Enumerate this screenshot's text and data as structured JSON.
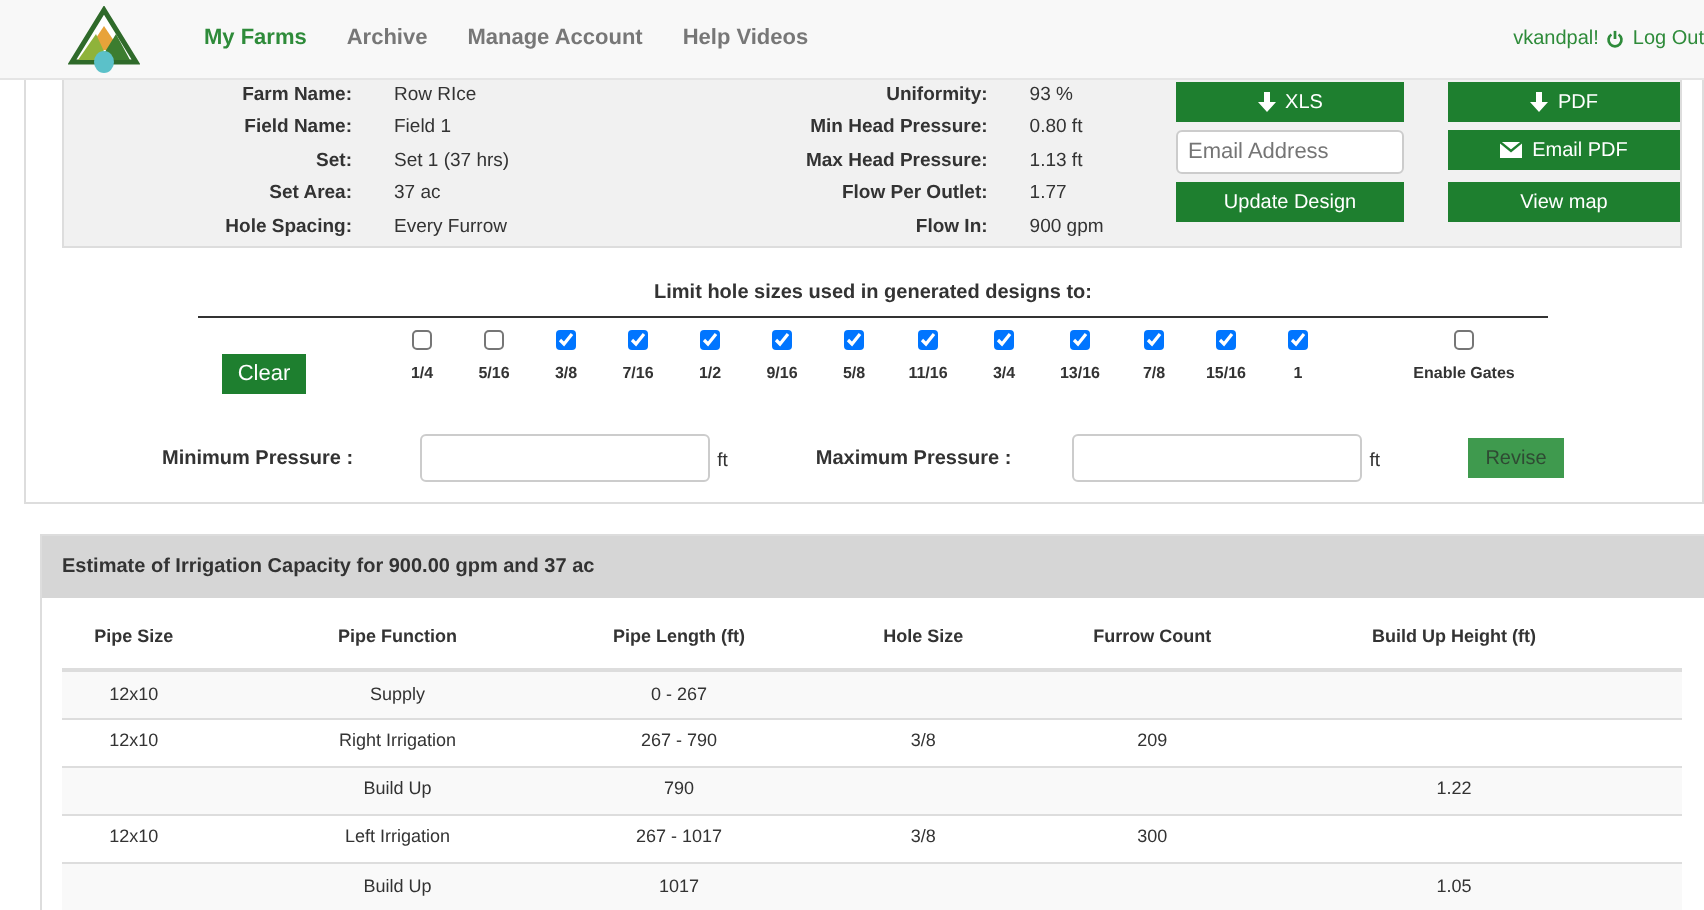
{
  "nav": {
    "items": [
      {
        "label": "My Farms",
        "selected": true
      },
      {
        "label": "Archive",
        "selected": false
      },
      {
        "label": "Manage Account",
        "selected": false
      },
      {
        "label": "Help Videos",
        "selected": false
      }
    ],
    "user": "vkandpal!",
    "logout": "Log Out"
  },
  "farm_info": {
    "left": [
      {
        "label": "Farm Name:",
        "value": "Row RIce"
      },
      {
        "label": "Field Name:",
        "value": "Field 1"
      },
      {
        "label": "Set:",
        "value": "Set 1 (37 hrs)"
      },
      {
        "label": "Set Area:",
        "value": "37 ac"
      },
      {
        "label": "Hole Spacing:",
        "value": "Every Furrow"
      }
    ],
    "right": [
      {
        "label": "Uniformity:",
        "value": "93 %"
      },
      {
        "label": "Min Head Pressure:",
        "value": "0.80 ft"
      },
      {
        "label": "Max Head Pressure:",
        "value": "1.13 ft"
      },
      {
        "label": "Flow Per Outlet:",
        "value": "1.77"
      },
      {
        "label": "Flow In:",
        "value": "900 gpm"
      }
    ]
  },
  "actions": {
    "xls": {
      "label": "XLS",
      "kind": "download"
    },
    "pdf": {
      "label": "PDF",
      "kind": "download"
    },
    "email_placeholder": "Email Address",
    "email_pdf": {
      "label": "Email PDF",
      "kind": "email"
    },
    "update": {
      "label": "Update Design"
    },
    "map": {
      "label": "View map"
    }
  },
  "hole_sizes": {
    "title": "Limit hole sizes used in generated designs to:",
    "clear": "Clear",
    "options": [
      {
        "label": "1/4",
        "checked": false
      },
      {
        "label": "5/16",
        "checked": false
      },
      {
        "label": "3/8",
        "checked": true
      },
      {
        "label": "7/16",
        "checked": true
      },
      {
        "label": "1/2",
        "checked": true
      },
      {
        "label": "9/16",
        "checked": true
      },
      {
        "label": "5/8",
        "checked": true
      },
      {
        "label": "11/16",
        "checked": true
      },
      {
        "label": "3/4",
        "checked": true
      },
      {
        "label": "13/16",
        "checked": true
      },
      {
        "label": "7/8",
        "checked": true
      },
      {
        "label": "15/16",
        "checked": true
      },
      {
        "label": "1",
        "checked": true
      }
    ],
    "enable_gates": {
      "label": "Enable Gates",
      "checked": false
    }
  },
  "pressure": {
    "min_label": "Minimum Pressure :",
    "min_unit": "ft",
    "max_label": "Maximum Pressure :",
    "max_unit": "ft",
    "revise": {
      "label": "Revise",
      "disabled": true
    }
  },
  "estimate": {
    "title": "Estimate of Irrigation Capacity for 900.00 gpm and 37 ac",
    "columns": [
      "Pipe Size",
      "Pipe Function",
      "Pipe Length (ft)",
      "Hole Size",
      "Furrow Count",
      "Build Up Height (ft)"
    ],
    "rows": [
      [
        "12x10",
        "Supply",
        "0 - 267",
        "",
        "",
        ""
      ],
      [
        "12x10",
        "Right Irrigation",
        "267 - 790",
        "3/8",
        "209",
        ""
      ],
      [
        "",
        "Build Up",
        "790",
        "",
        "",
        "1.22"
      ],
      [
        "12x10",
        "Left Irrigation",
        "267 - 1017",
        "3/8",
        "300",
        ""
      ],
      [
        "",
        "Build Up",
        "1017",
        "",
        "",
        "1.05"
      ]
    ]
  }
}
